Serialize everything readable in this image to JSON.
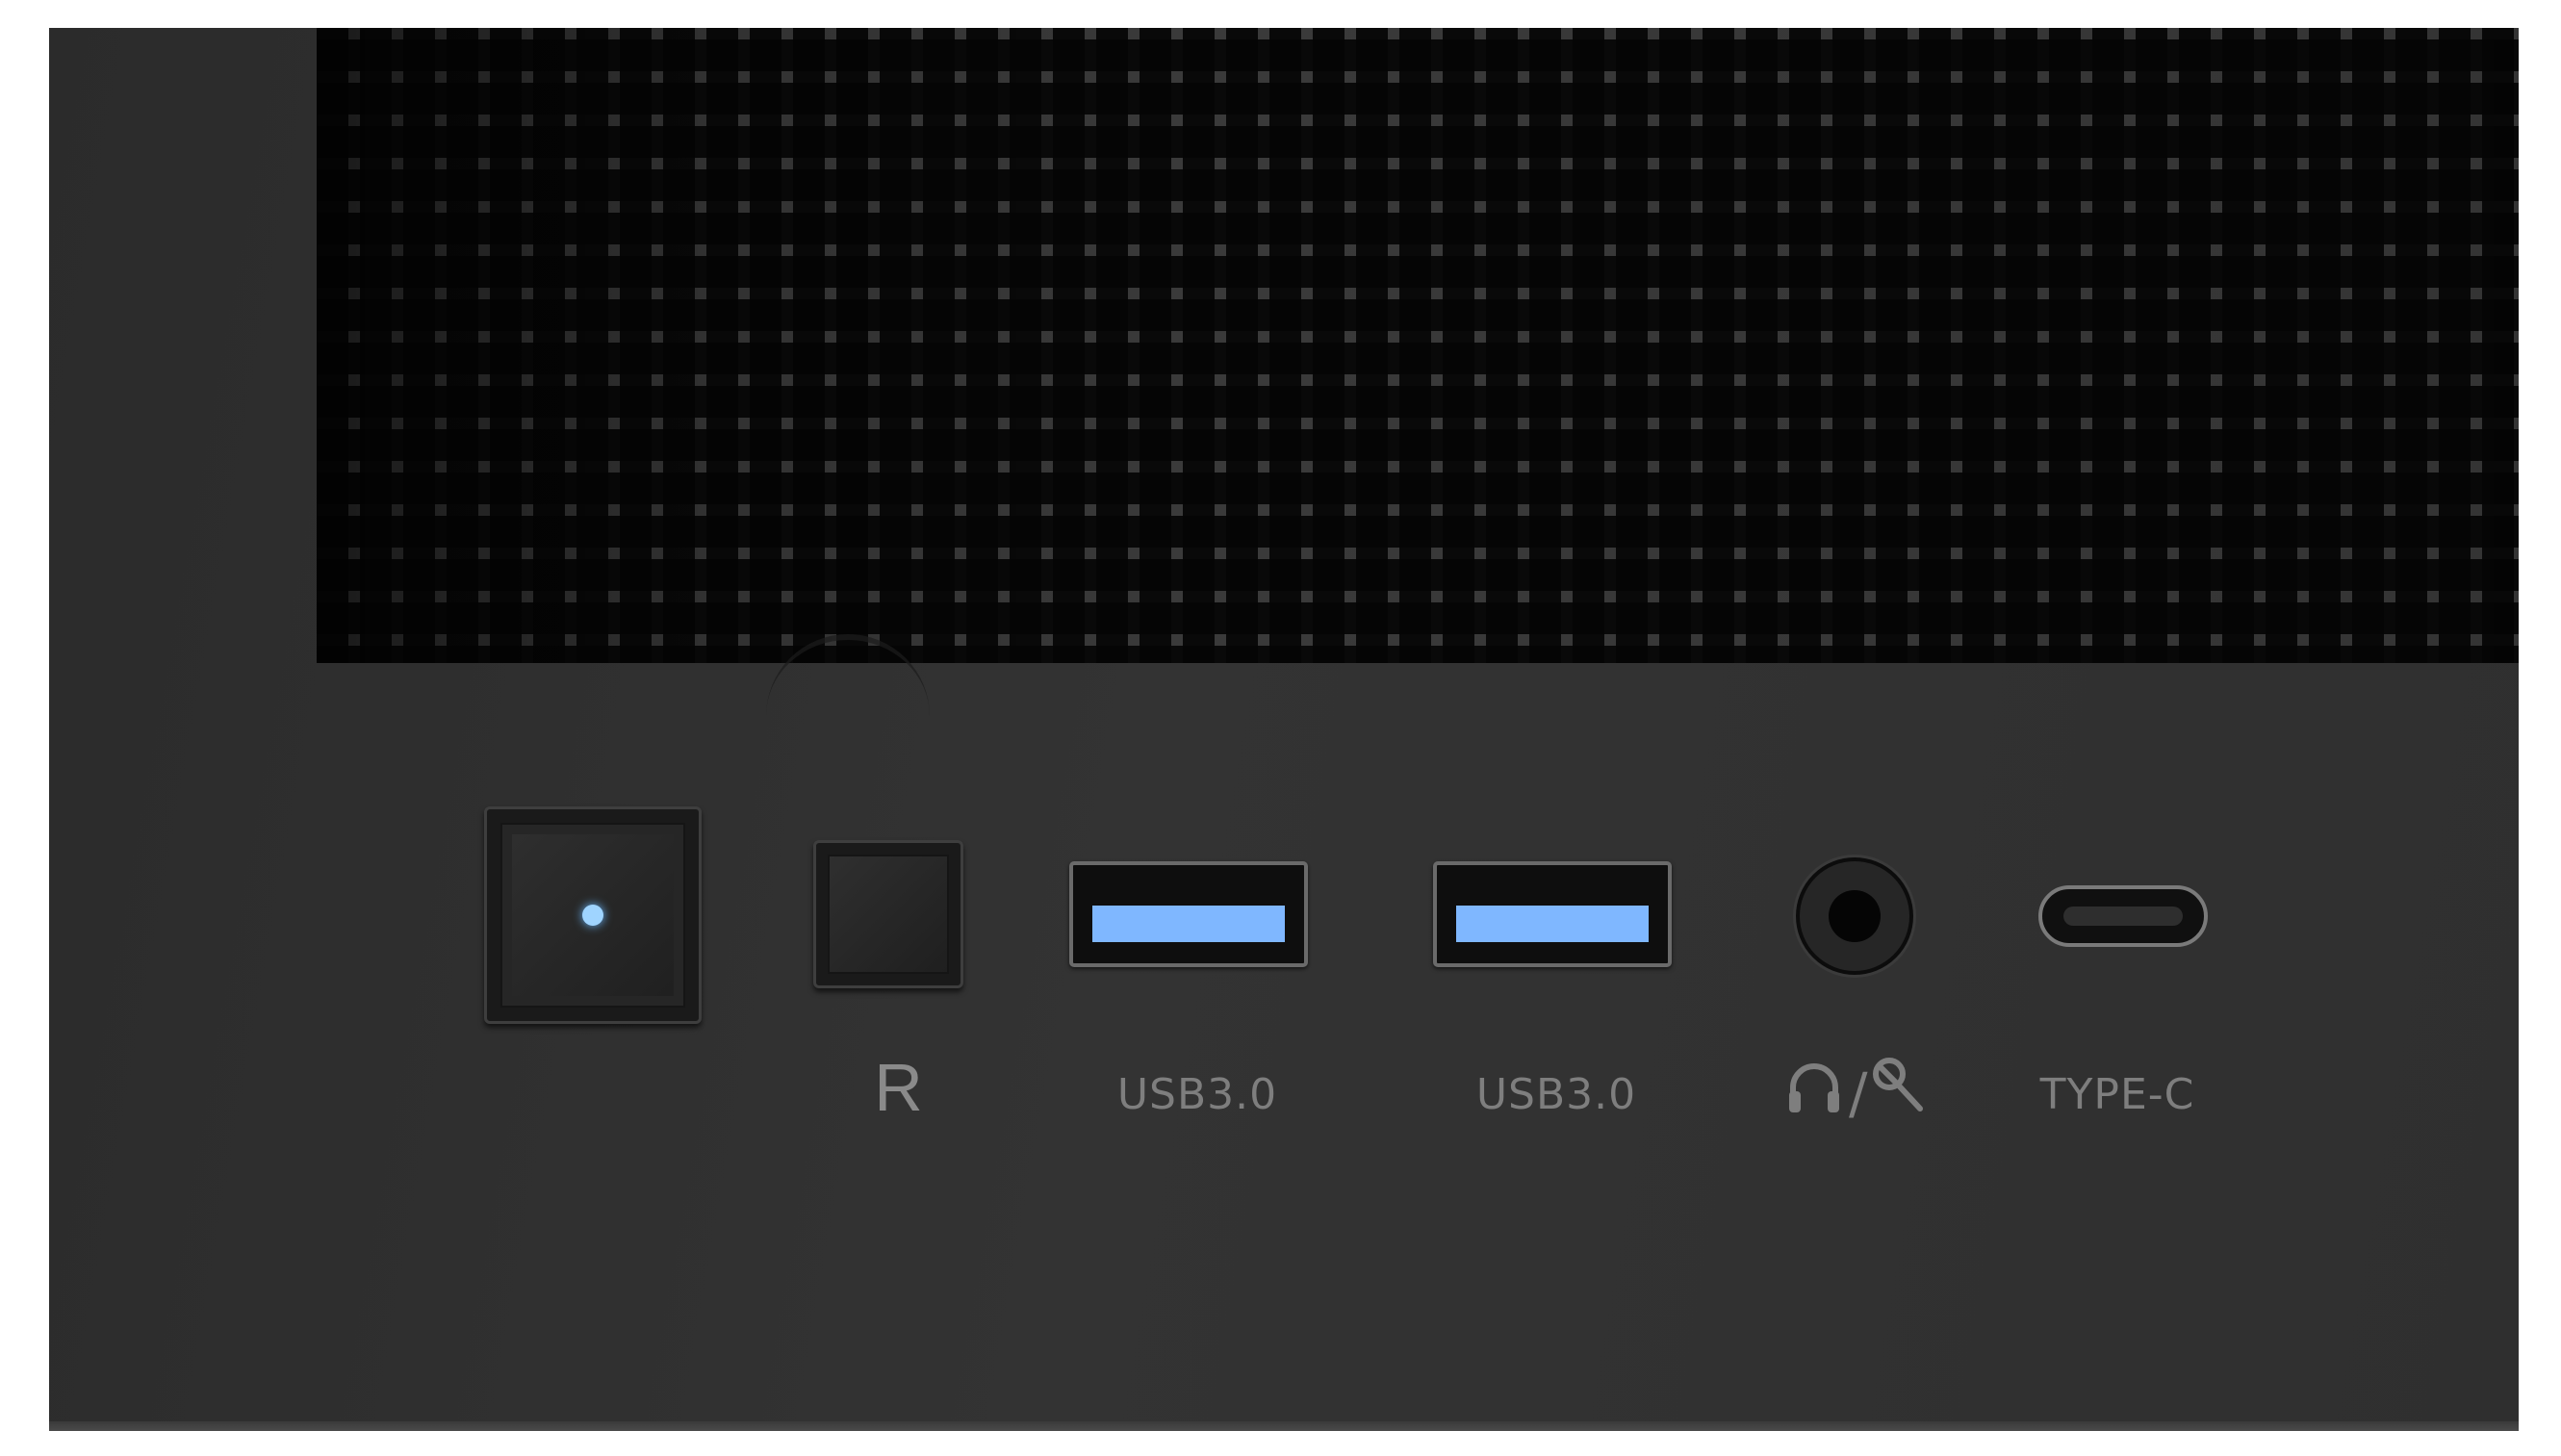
{
  "front_panel": {
    "labels": {
      "reset": "R",
      "usb_1": "USB3.0",
      "usb_2": "USB3.0",
      "audio_symbol": "/",
      "type_c": "TYPE-C"
    },
    "colors": {
      "panel": "#2f2f2f",
      "usb_tongue": "#7fb7ff",
      "power_led": "#9fd4ff",
      "label_text": "#7e7e7e"
    },
    "icons": {
      "audio": [
        "headphone-icon",
        "microphone-icon"
      ]
    }
  }
}
